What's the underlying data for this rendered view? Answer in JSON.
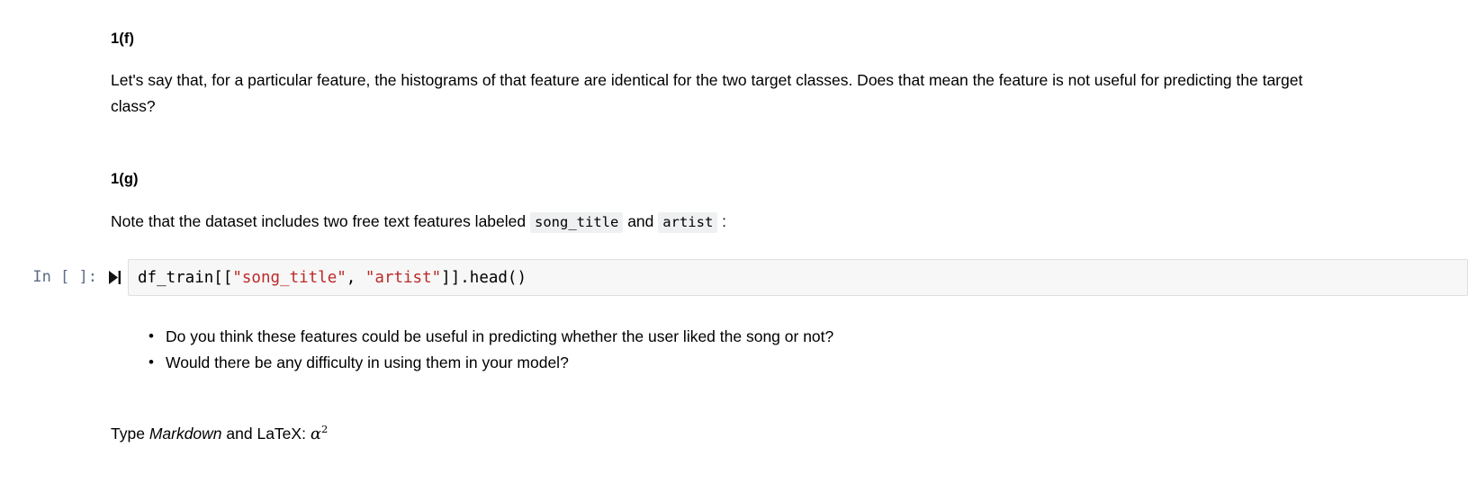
{
  "notebook": {
    "cells": {
      "heading_1f": "1(f)",
      "para_1f": "Let's say that, for a particular feature, the histograms of that feature are identical for the two target classes. Does that mean the feature is not useful for predicting the target class?",
      "heading_1g": "1(g)",
      "para_1g_before": "Note that the dataset includes two free text features labeled",
      "code_song_title": "song_title",
      "para_1g_middle": "and",
      "code_artist": "artist",
      "para_1g_after": ":",
      "bullets": [
        "Do you think these features could be useful in predicting whether the user liked the song or not?",
        "Would there be any difficulty in using them in your model?"
      ],
      "latex_prefix": "Type ",
      "latex_markdown_word": "Markdown",
      "latex_middle": " and LaTeX: ",
      "latex_math_base": "α",
      "latex_math_exp": "2"
    },
    "code_cell": {
      "prompt": "In [ ]:",
      "run_icon_name": "step-forward-icon",
      "code_segments": [
        {
          "text": "df_train[[",
          "type": "plain"
        },
        {
          "text": "\"song_title\"",
          "type": "string"
        },
        {
          "text": ", ",
          "type": "plain"
        },
        {
          "text": "\"artist\"",
          "type": "string"
        },
        {
          "text": "]].head()",
          "type": "plain"
        }
      ],
      "code_full": "df_train[[\"song_title\", \"artist\"]].head()"
    },
    "colors": {
      "prompt": "#5b6b86",
      "string_token": "#bb2a2a",
      "cell_background": "#f7f7f7",
      "cell_border": "#dfdfdf",
      "inline_code_background": "#eff0f1",
      "page_background": "#ffffff",
      "text": "#000000"
    }
  }
}
